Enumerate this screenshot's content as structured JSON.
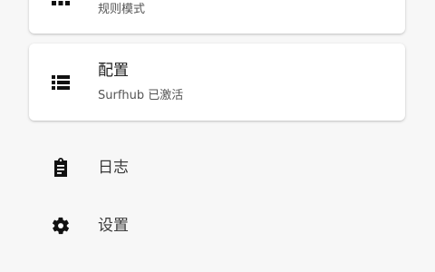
{
  "mode_card": {
    "subtitle": "规则模式",
    "icon": "grid-icon"
  },
  "config_card": {
    "title": "配置",
    "subtitle": "Surfhub 已激活",
    "icon": "list-icon"
  },
  "nav": {
    "logs": {
      "label": "日志",
      "icon": "clipboard-icon"
    },
    "settings": {
      "label": "设置",
      "icon": "gear-icon"
    }
  },
  "colors": {
    "background": "#f7f7f7",
    "card": "#ffffff",
    "icon": "#111111"
  }
}
